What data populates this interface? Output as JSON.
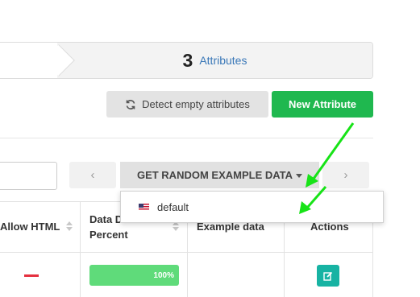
{
  "steps": {
    "count": "3",
    "label": "Attributes"
  },
  "toolbar": {
    "detect_label": "Detect empty attributes",
    "new_label": "New Attribute"
  },
  "pager": {
    "prev": "‹",
    "next": "›"
  },
  "random_button": {
    "label": "GET RANDOM EXAMPLE DATA"
  },
  "table": {
    "headers": {
      "allow_html": "Allow HTML",
      "data_density_line1": "Data D",
      "data_density_line2": "Percent",
      "example_data": "Example data",
      "actions": "Actions"
    },
    "rows": [
      {
        "allow_html": "—",
        "density": "100%"
      }
    ]
  },
  "dropdown": {
    "options": [
      {
        "label": "default",
        "icon": "us-flag-icon"
      }
    ]
  },
  "colors": {
    "accent_green": "#1fb84f",
    "link_blue": "#3a78b8",
    "progress_green": "#5fdb7a",
    "teal": "#17b3a3",
    "annotation_green": "#17e317"
  }
}
